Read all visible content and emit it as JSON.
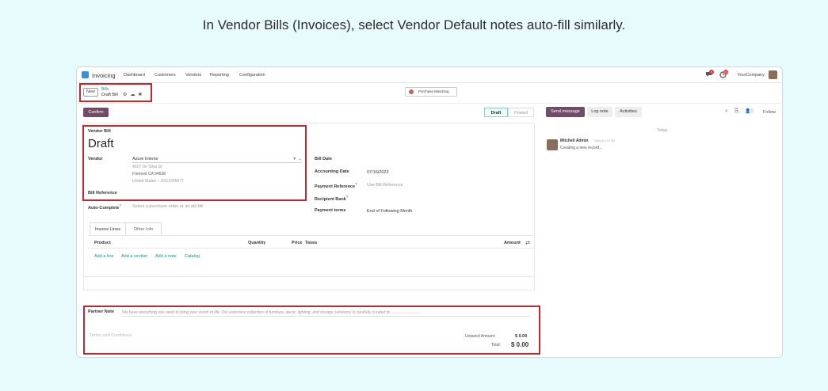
{
  "caption": "In Vendor Bills (Invoices), select Vendor Default notes auto-fill similarly.",
  "navbar": {
    "app": "Invoicing",
    "menu": [
      "Dashboard",
      "Customers",
      "Vendors",
      "Reporting",
      "Configuration"
    ],
    "company": "YourCompany",
    "msg_count": "4",
    "activity_count": "11"
  },
  "control": {
    "new_label": "New",
    "breadcrumb_parent": "Bills",
    "breadcrumb_current": "Draft Bill",
    "purchase_matching": "Purchase Matching"
  },
  "actions": {
    "confirm": "Confirm",
    "status_draft": "Draft",
    "status_posted": "Posted"
  },
  "form": {
    "doc_type": "Vendor Bill",
    "doc_name": "Draft",
    "vendor_label": "Vendor",
    "vendor_value": "Azure Interior",
    "vendor_address_1": "4557 De Silva St",
    "vendor_address_2": "Fremont CA 94538",
    "vendor_address_3": "United States – US12345677",
    "bill_reference_label": "Bill Reference",
    "auto_complete_label": "Auto-Complete",
    "auto_complete_placeholder": "Select a purchase order or an old bill",
    "bill_date_label": "Bill Date",
    "accounting_date_label": "Accounting Date",
    "accounting_date_value": "07/16/2023",
    "payment_reference_label": "Payment Reference",
    "payment_reference_placeholder": "Use Bill Reference",
    "recipient_bank_label": "Recipient Bank",
    "payment_terms_label": "Payment terms",
    "payment_terms_value": "End of Following Month"
  },
  "tabs": [
    "Invoice Lines",
    "Other Info"
  ],
  "lines": {
    "columns": [
      "Product",
      "Quantity",
      "Price",
      "Taxes",
      "Amount"
    ],
    "add_links": [
      "Add a line",
      "Add a section",
      "Add a note",
      "Catalog"
    ]
  },
  "notes": {
    "partner_note_label": "Partner Note",
    "partner_note_text": "We have everything you need to bring your vision to life. Our extensive collection of furniture, decor, lighting, and storage solutions/ is carefully curated to ............................",
    "terms_placeholder": "Terms and Conditions",
    "untaxed_label": "Untaxed Amount:",
    "untaxed_value": "$ 0.00",
    "total_label": "Total:",
    "total_value": "$ 0.00"
  },
  "chatter": {
    "send_message": "Send message",
    "log_note": "Log note",
    "activities": "Activities",
    "follow": "Follow",
    "follower_count": "0",
    "today": "Today",
    "author": "Mitchell Admin",
    "time": "Today at 4:47 PM",
    "message": "Creating a new record..."
  },
  "colors": {
    "brand": "#714b67",
    "highlight": "#c0282f",
    "link": "#1f8b9b",
    "background": "#e8fbfc"
  }
}
